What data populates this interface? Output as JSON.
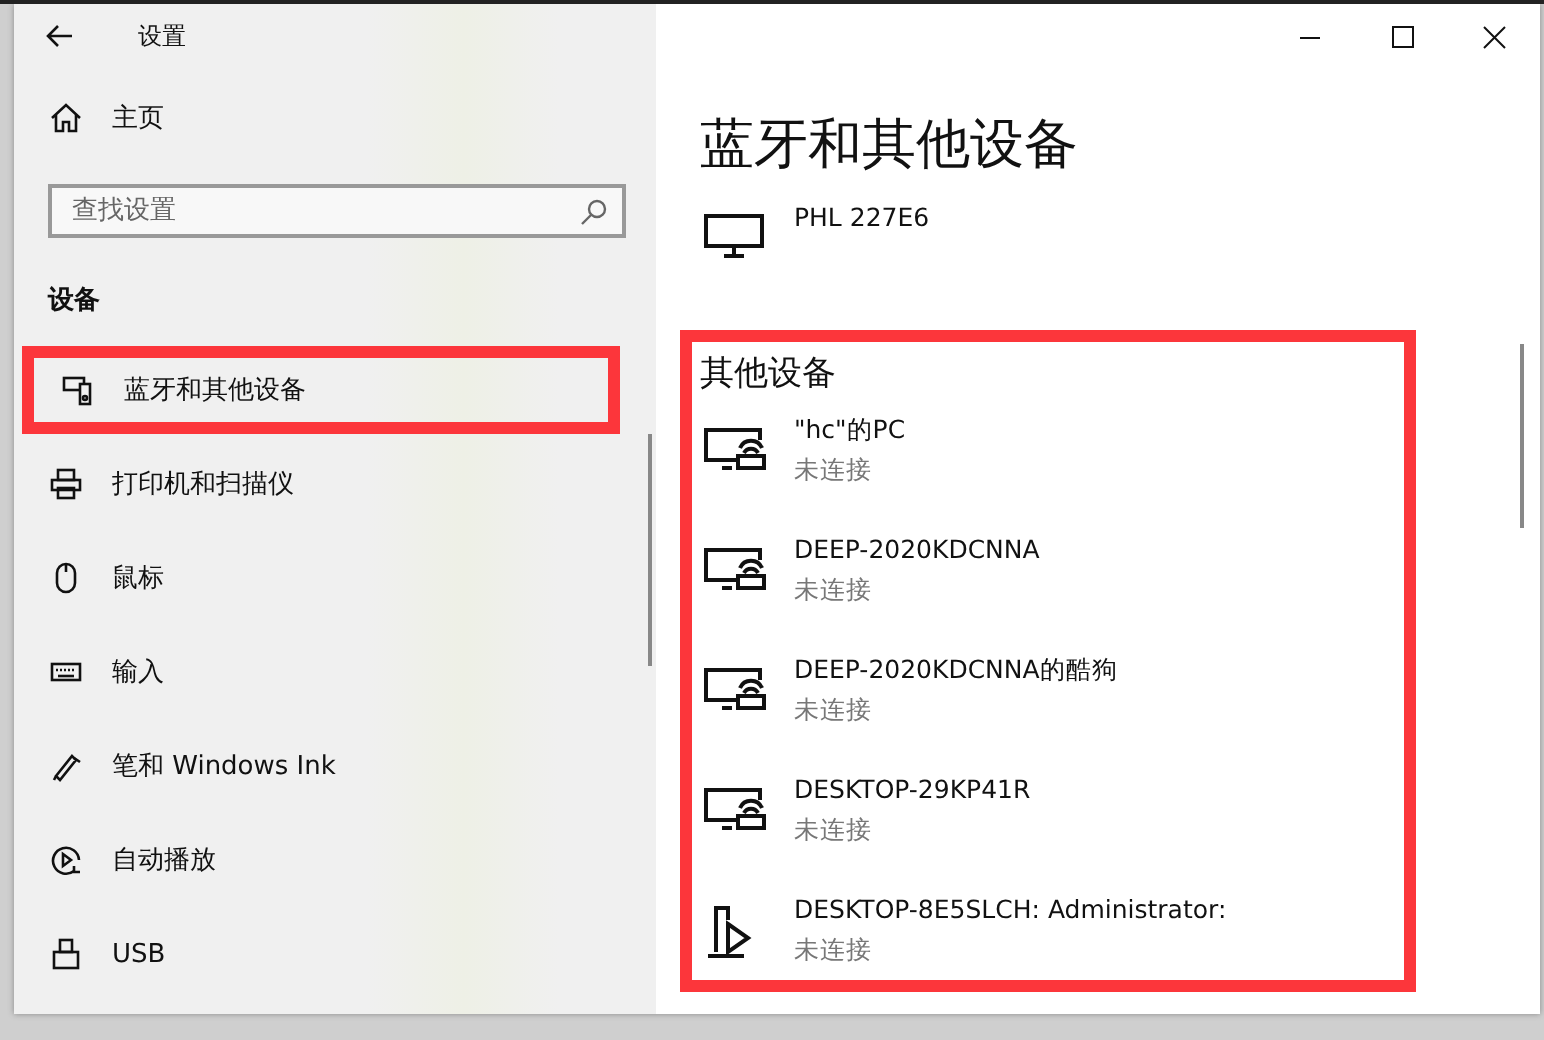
{
  "window": {
    "title": "设置"
  },
  "sidebar": {
    "home": "主页",
    "search": {
      "placeholder": "查找设置"
    },
    "heading": "设备",
    "items": [
      {
        "label": "蓝牙和其他设备",
        "highlighted": true
      },
      {
        "label": "打印机和扫描仪",
        "highlighted": false
      },
      {
        "label": "鼠标",
        "highlighted": false
      },
      {
        "label": "输入",
        "highlighted": false
      },
      {
        "label": "笔和 Windows Ink",
        "highlighted": false
      },
      {
        "label": "自动播放",
        "highlighted": false
      },
      {
        "label": "USB",
        "highlighted": false
      }
    ]
  },
  "main": {
    "title": "蓝牙和其他设备",
    "top_devices": [
      {
        "name": "PHL 227E6",
        "kind": "monitor"
      }
    ],
    "other_devices": {
      "heading": "其他设备",
      "highlighted": true,
      "items": [
        {
          "name": "\"hc\"的PC",
          "status": "未连接",
          "kind": "network-pc"
        },
        {
          "name": "DEEP-2020KDCNNA",
          "status": "未连接",
          "kind": "network-pc"
        },
        {
          "name": "DEEP-2020KDCNNA的酷狗",
          "status": "未连接",
          "kind": "network-pc"
        },
        {
          "name": "DESKTOP-29KP41R",
          "status": "未连接",
          "kind": "network-pc"
        },
        {
          "name": "DESKTOP-8E5SLCH: Administrator:",
          "status": "未连接",
          "kind": "media-device"
        }
      ]
    }
  }
}
